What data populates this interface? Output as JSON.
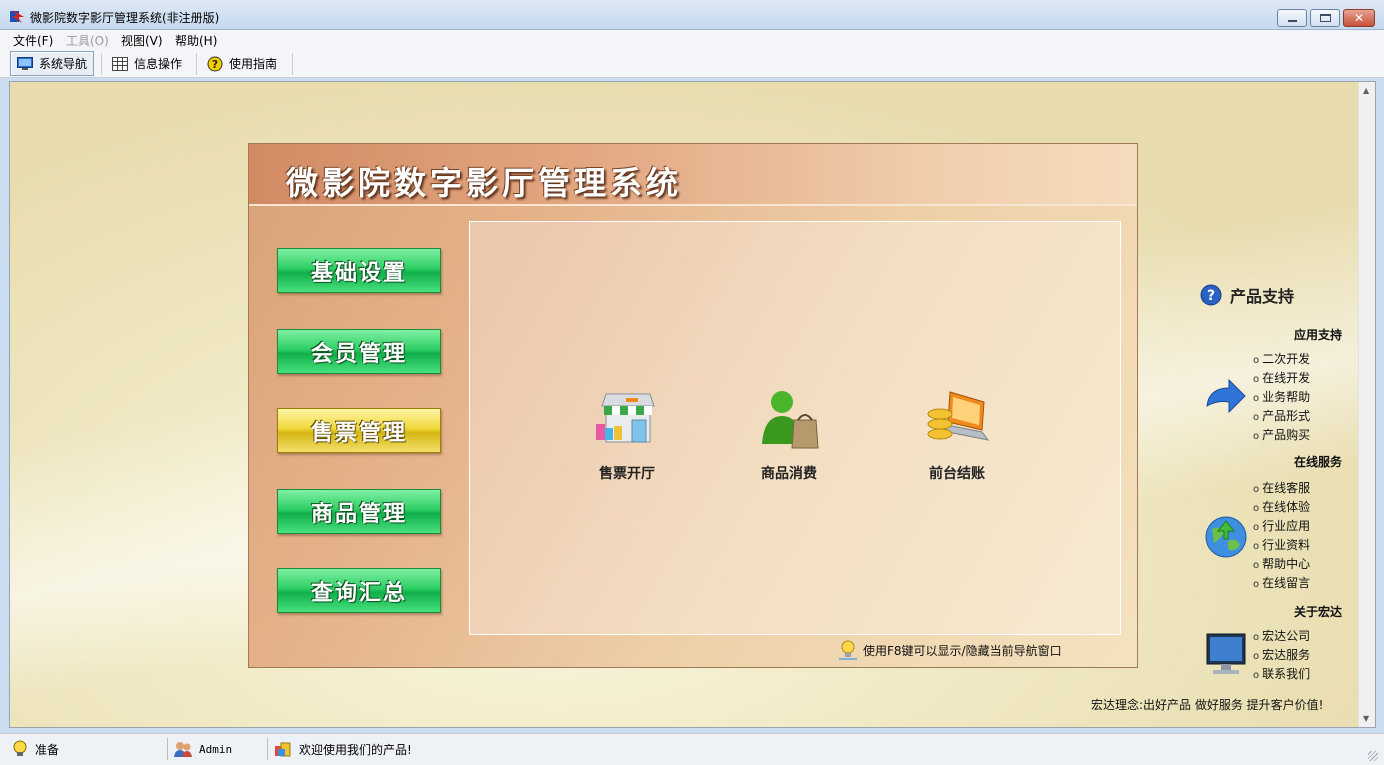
{
  "window": {
    "title": "微影院数字影厅管理系统(非注册版)",
    "controls": {
      "close_label": "✕"
    }
  },
  "menu": [
    {
      "label": "文件(F)",
      "enabled": true
    },
    {
      "label": "工具(O)",
      "enabled": false
    },
    {
      "label": "视图(V)",
      "enabled": true
    },
    {
      "label": "帮助(H)",
      "enabled": true
    }
  ],
  "toolbar": [
    {
      "label": "系统导航",
      "icon": "monitor-icon",
      "active": true
    },
    {
      "label": "信息操作",
      "icon": "grid-icon",
      "active": false
    },
    {
      "label": "使用指南",
      "icon": "help-icon",
      "active": false
    }
  ],
  "panel": {
    "title": "微影院数字影厅管理系统",
    "nav_buttons": [
      {
        "label": "基础设置",
        "selected": false
      },
      {
        "label": "会员管理",
        "selected": false
      },
      {
        "label": "售票管理",
        "selected": true
      },
      {
        "label": "商品管理",
        "selected": false
      },
      {
        "label": "查询汇总",
        "selected": false
      }
    ],
    "features": [
      {
        "label": "售票开厅",
        "icon": "storefront-icon"
      },
      {
        "label": "商品消费",
        "icon": "shopper-icon"
      },
      {
        "label": "前台结账",
        "icon": "cashier-icon"
      }
    ],
    "hint": "使用F8键可以显示/隐藏当前导航窗口"
  },
  "support": {
    "title": "产品支持",
    "sections": [
      {
        "title": "应用支持",
        "links": [
          "二次开发",
          "在线开发",
          "业务帮助",
          "产品形式",
          "产品购买"
        ]
      },
      {
        "title": "在线服务",
        "links": [
          "在线客服",
          "在线体验",
          "行业应用",
          "行业资料",
          "帮助中心",
          "在线留言"
        ]
      },
      {
        "title": "关于宏达",
        "links": [
          "宏达公司",
          "宏达服务",
          "联系我们"
        ]
      }
    ],
    "motto": "宏达理念:出好产品 做好服务 提升客户价值!"
  },
  "statusbar": {
    "status": "准备",
    "user": "Admin",
    "message": "欢迎使用我们的产品!"
  },
  "colors": {
    "nav_button_green": "#2ecf66",
    "nav_button_selected": "#f0d83a",
    "panel_brown": "#d9a277"
  }
}
